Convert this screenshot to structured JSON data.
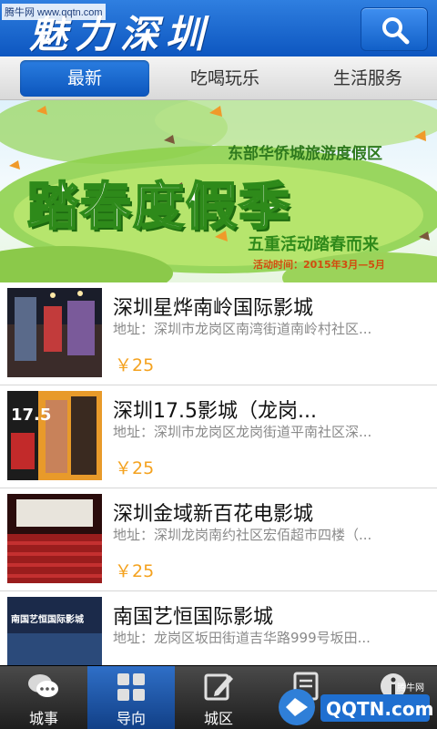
{
  "watermark": {
    "top": "腾牛网 www.qqtn.com",
    "bottom_logo": "QQTN.com",
    "bottom_small": "腾牛网"
  },
  "header": {
    "title": "魅力深圳",
    "search_icon": "search-icon"
  },
  "tabs": [
    {
      "label": "最新",
      "active": true
    },
    {
      "label": "吃喝玩乐",
      "active": false
    },
    {
      "label": "生活服务",
      "active": false
    }
  ],
  "banner": {
    "subtitle": "东部华侨城旅游度假区",
    "main": "踏春度假季",
    "slogan": "五重活动踏春而来",
    "date": "活动时间：2015年3月—5月"
  },
  "cinemas": [
    {
      "name": "深圳星烨南岭国际影城",
      "address": "地址：深圳市龙岗区南湾街道南岭村社区...",
      "price": "￥25"
    },
    {
      "name": "深圳17.5影城（龙岗...",
      "address": "地址：深圳市龙岗区龙岗街道平南社区深...",
      "price": "￥25"
    },
    {
      "name": "深圳金域新百花电影城",
      "address": "地址：深圳龙岗南约社区宏佰超市四楼（...",
      "price": "￥25"
    },
    {
      "name": "南国艺恒国际影城",
      "address": "地址：龙岗区坂田街道吉华路999号坂田...",
      "price": ""
    }
  ],
  "thumbs": {
    "t2_text": "17.5",
    "t4_text": "南国艺恒国际影城"
  },
  "bottom_nav": [
    {
      "label": "城事",
      "icon": "chat-bubbles-icon",
      "active": false
    },
    {
      "label": "导向",
      "icon": "grid-icon",
      "active": true
    },
    {
      "label": "城区",
      "icon": "edit-icon",
      "active": false
    },
    {
      "label": "",
      "icon": "document-icon",
      "active": false
    },
    {
      "label": "",
      "icon": "info-icon",
      "active": false
    }
  ],
  "colors": {
    "header_blue": "#1a66cf",
    "price_orange": "#f4a21f",
    "banner_green": "#2f8a1a"
  }
}
